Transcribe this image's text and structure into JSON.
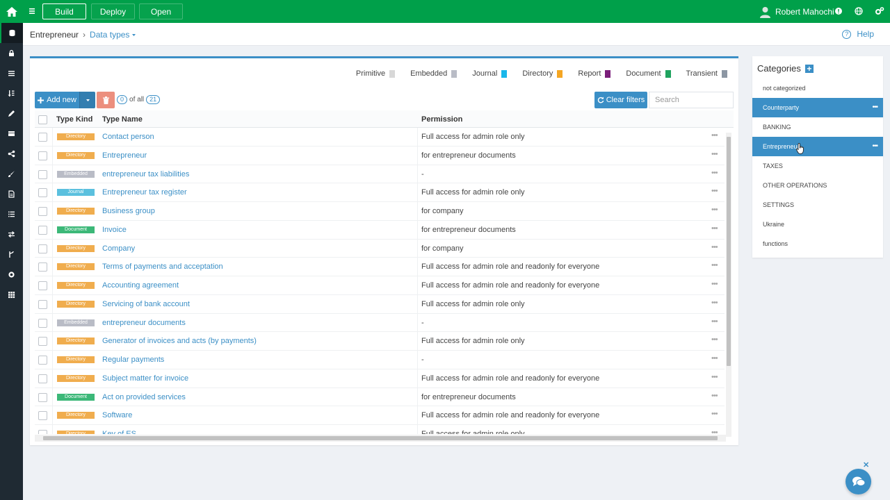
{
  "topbar": {
    "buttons": [
      "Build",
      "Deploy",
      "Open"
    ],
    "user_name": "Robert Mahochi"
  },
  "rail": {
    "icons": [
      "database-icon",
      "lock-icon",
      "list-icon",
      "sort-icon",
      "pencil-icon",
      "table-icon",
      "share-icon",
      "brush-icon",
      "document-icon",
      "list-ordered-icon",
      "exchange-icon",
      "branch-icon",
      "gear-icon",
      "grid-icon"
    ]
  },
  "breadcrumb": {
    "root": "Entrepreneur",
    "separator": "›",
    "current": "Data types"
  },
  "help_label": "Help",
  "legend": [
    {
      "label": "Primitive",
      "color": "#d8d8d8"
    },
    {
      "label": "Embedded",
      "color": "#b9bcc6"
    },
    {
      "label": "Journal",
      "color": "#1ab7ea"
    },
    {
      "label": "Directory",
      "color": "#f5a623"
    },
    {
      "label": "Report",
      "color": "#7b1e7a"
    },
    {
      "label": "Document",
      "color": "#1fa35f"
    },
    {
      "label": "Transient",
      "color": "#8c96a3"
    }
  ],
  "toolbar": {
    "add_label": "Add new",
    "selected_count": "0",
    "of_all_label": "of all",
    "total_count": "21",
    "clear_label": "Clear filters",
    "search_placeholder": "Search"
  },
  "table": {
    "headers": {
      "kind": "Type Kind",
      "name": "Type Name",
      "permission": "Permission"
    },
    "rows": [
      {
        "kind": "Directory",
        "name": "Contact person",
        "permission": "Full access for admin role only"
      },
      {
        "kind": "Directory",
        "name": "Entrepreneur",
        "permission": "for entrepreneur documents"
      },
      {
        "kind": "Embedded",
        "name": "entrepreneur tax liabilities",
        "permission": "-"
      },
      {
        "kind": "Journal",
        "name": "Entrepreneur tax register",
        "permission": "Full access for admin role only"
      },
      {
        "kind": "Directory",
        "name": "Business group",
        "permission": "for company"
      },
      {
        "kind": "Document",
        "name": "Invoice",
        "permission": "for entrepreneur documents"
      },
      {
        "kind": "Directory",
        "name": "Company",
        "permission": "for company"
      },
      {
        "kind": "Directory",
        "name": "Terms of payments and acceptation",
        "permission": "Full access for admin role and readonly for everyone"
      },
      {
        "kind": "Directory",
        "name": "Accounting agreement",
        "permission": "Full access for admin role and readonly for everyone"
      },
      {
        "kind": "Directory",
        "name": "Servicing of bank account",
        "permission": "Full access for admin role only"
      },
      {
        "kind": "Embedded",
        "name": "entrepreneur documents",
        "permission": "-"
      },
      {
        "kind": "Directory",
        "name": "Generator of invoices and acts (by payments)",
        "permission": "Full access for admin role only"
      },
      {
        "kind": "Directory",
        "name": "Regular payments",
        "permission": "-"
      },
      {
        "kind": "Directory",
        "name": "Subject matter for invoice",
        "permission": "Full access for admin role and readonly for everyone"
      },
      {
        "kind": "Document",
        "name": "Act on provided services",
        "permission": "for entrepreneur documents"
      },
      {
        "kind": "Directory",
        "name": "Software",
        "permission": "Full access for admin role and readonly for everyone"
      },
      {
        "kind": "Directory",
        "name": "Key of ES",
        "permission": "Full access for admin role only"
      }
    ]
  },
  "categories": {
    "title": "Categories",
    "items": [
      {
        "label": "not categorized",
        "selected": false
      },
      {
        "label": "Counterparty",
        "selected": true
      },
      {
        "label": "BANKING",
        "selected": false
      },
      {
        "label": "Entrepreneur",
        "selected": true
      },
      {
        "label": "TAXES",
        "selected": false
      },
      {
        "label": "OTHER OPERATIONS",
        "selected": false
      },
      {
        "label": "SETTINGS",
        "selected": false
      },
      {
        "label": "Ukraine",
        "selected": false
      },
      {
        "label": "functions",
        "selected": false
      }
    ]
  },
  "kind_colors": {
    "Directory": "#f0ad4e",
    "Embedded": "#b9bcc6",
    "Journal": "#5bc0de",
    "Document": "#3cb878"
  }
}
